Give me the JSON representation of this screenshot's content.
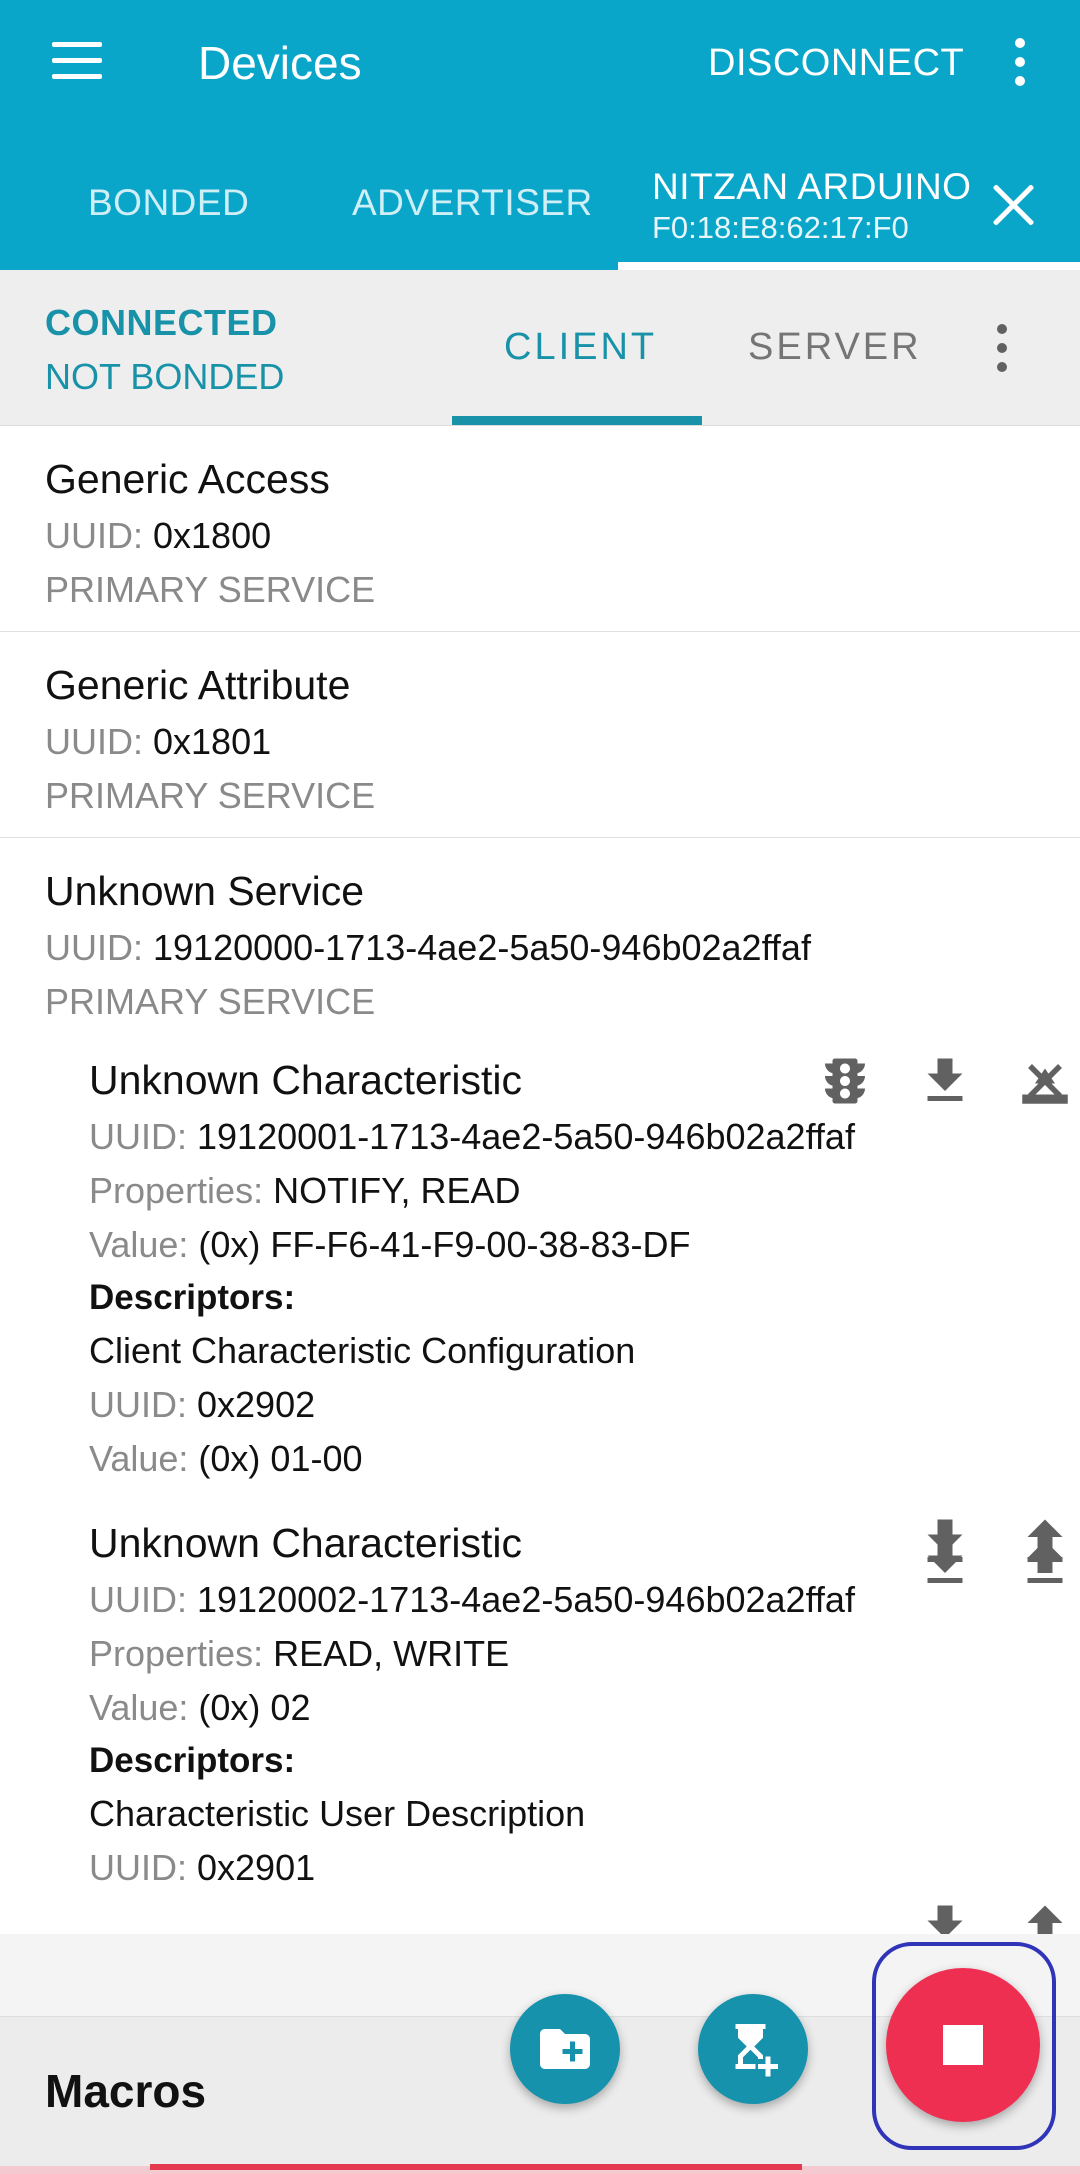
{
  "app_bar": {
    "title": "Devices",
    "disconnect_label": "DISCONNECT",
    "tabs": [
      {
        "label": "BONDED"
      },
      {
        "label": "ADVERTISER"
      }
    ],
    "device": {
      "name": "NITZAN ARDUINO",
      "address": "F0:18:E8:62:17:F0"
    }
  },
  "connection": {
    "state": "CONNECTED",
    "bond": "NOT BONDED",
    "tabs": [
      {
        "label": "CLIENT"
      },
      {
        "label": "SERVER"
      }
    ]
  },
  "services": [
    {
      "name": "Generic Access",
      "uuid_label": "UUID:",
      "uuid": "0x1800",
      "type": "PRIMARY SERVICE"
    },
    {
      "name": "Generic Attribute",
      "uuid_label": "UUID:",
      "uuid": "0x1801",
      "type": "PRIMARY SERVICE"
    },
    {
      "name": "Unknown Service",
      "uuid_label": "UUID:",
      "uuid": "19120000-1713-4ae2-5a50-946b02a2ffaf",
      "type": "PRIMARY SERVICE",
      "characteristics": [
        {
          "name": "Unknown Characteristic",
          "uuid_label": "UUID:",
          "uuid": "19120001-1713-4ae2-5a50-946b02a2ffaf",
          "properties_label": "Properties:",
          "properties": "NOTIFY, READ",
          "value_label": "Value:",
          "value": "(0x) FF-F6-41-F9-00-38-83-DF",
          "descriptors_label": "Descriptors:",
          "descriptor": {
            "name": "Client Characteristic Configuration",
            "uuid_label": "UUID:",
            "uuid": "0x2902",
            "value_label": "Value:",
            "value": "(0x) 01-00"
          }
        },
        {
          "name": "Unknown Characteristic",
          "uuid_label": "UUID:",
          "uuid": "19120002-1713-4ae2-5a50-946b02a2ffaf",
          "properties_label": "Properties:",
          "properties": "READ, WRITE",
          "value_label": "Value:",
          "value": "(0x) 02",
          "descriptors_label": "Descriptors:",
          "descriptor": {
            "name": "Characteristic User Description",
            "uuid_label": "UUID:",
            "uuid": "0x2901"
          }
        }
      ]
    }
  ],
  "macros": {
    "title": "Macros"
  },
  "icons": {
    "menu": "menu-icon",
    "overflow": "more-vert-icon",
    "close": "close-icon",
    "traffic_light": "traffic-light-icon",
    "download": "download-icon",
    "upload": "upload-icon",
    "notify_off": "notifications-off-icon",
    "new_folder": "folder-add-icon",
    "record_macro": "hourglass-add-icon",
    "stop": "stop-icon"
  },
  "colors": {
    "primary": "#0aa6c9",
    "accent": "#1792a8",
    "fab": "#1692ad",
    "stop": "#ef2f52",
    "highlight": "#3034b8"
  }
}
